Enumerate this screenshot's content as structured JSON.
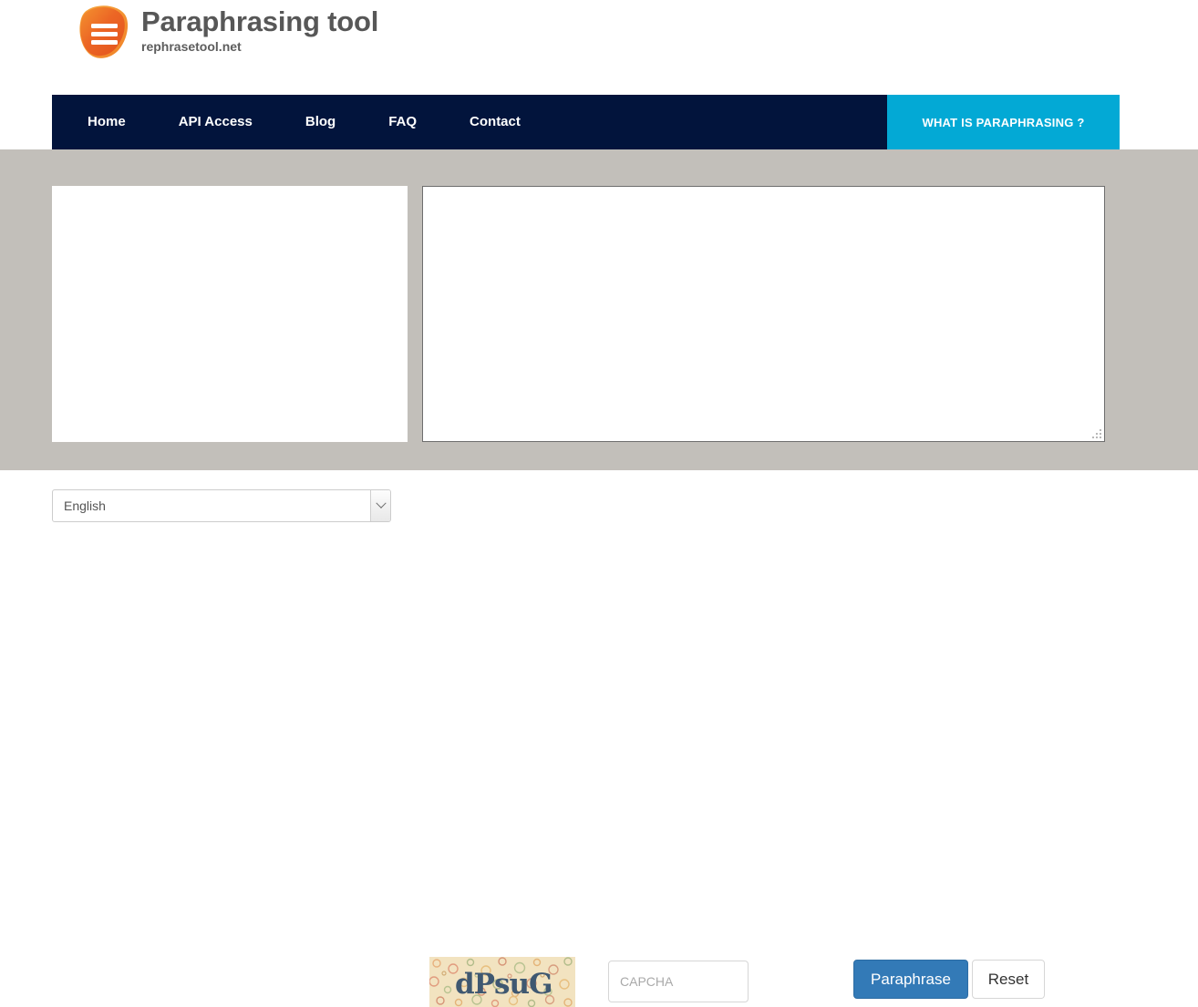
{
  "header": {
    "logo_icon": "hamburger-logo-icon",
    "title": "Paraphrasing tool",
    "tagline": "rephrasetool.net",
    "logo_color": "#ec6625",
    "title_color": "#575757"
  },
  "nav": {
    "background": "#02143c",
    "items": [
      {
        "label": "Home"
      },
      {
        "label": "API Access"
      },
      {
        "label": "Blog"
      },
      {
        "label": "FAQ"
      },
      {
        "label": "Contact"
      }
    ],
    "cta": {
      "label": "WHAT IS PARAPHRASING ?",
      "background": "#03a9d5"
    }
  },
  "workspace": {
    "background": "#c2bfba",
    "input_textarea": {
      "value": "",
      "placeholder": ""
    },
    "output_textarea": {
      "value": "",
      "placeholder": ""
    }
  },
  "controls": {
    "language": {
      "selected": "English",
      "options": [
        "English"
      ],
      "arrow_icon": "chevron-down-icon"
    },
    "captcha": {
      "image_text": "dPsuG",
      "input_value": "",
      "input_placeholder": "CAPCHA"
    },
    "paraphrase_button": {
      "label": "Paraphrase",
      "background": "#337ab7"
    },
    "reset_button": {
      "label": "Reset"
    }
  }
}
